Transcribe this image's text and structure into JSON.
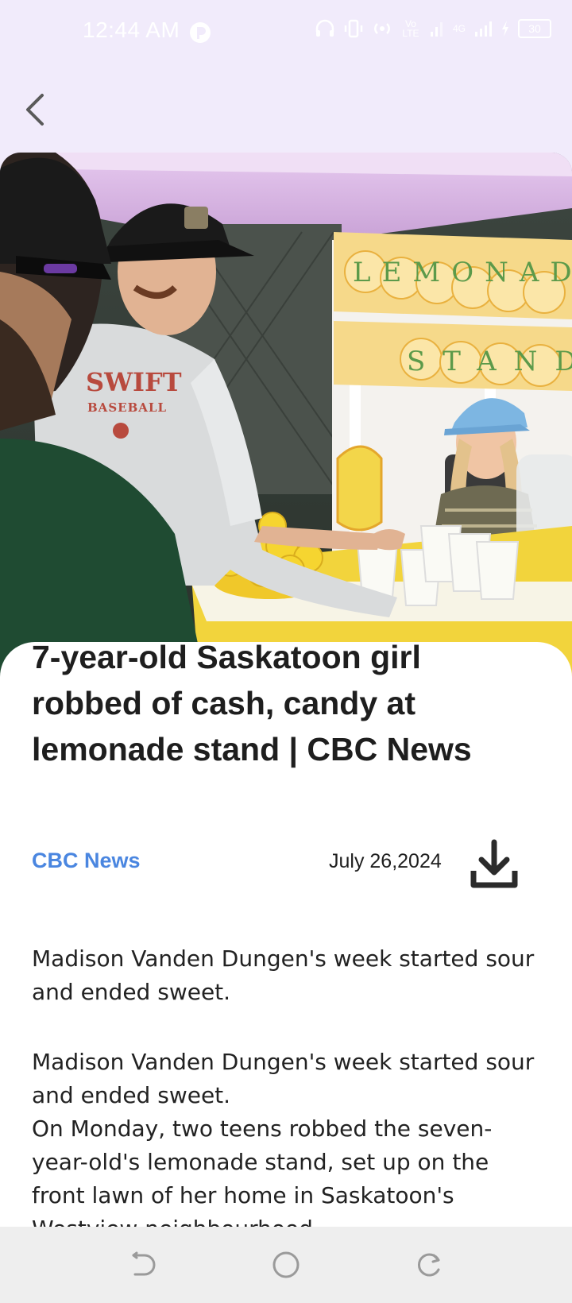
{
  "status_bar": {
    "time": "12:44 AM",
    "battery": "30",
    "network": "4G",
    "volte": "Vo LTE"
  },
  "top_bar": {
    "back_icon": "chevron-left-icon"
  },
  "hero_image": {
    "alt": "Swift Baseball players at a lemonade stand run by a girl in a blue cap"
  },
  "hero_banner": {
    "line1": "LEMONADE",
    "line2": "STAND"
  },
  "hero_shirt": {
    "line1": "SWIFT",
    "line2": "BASEBALL"
  },
  "article": {
    "headline": "7-year-old Saskatoon girl robbed of cash, candy at lemonade stand | CBC News",
    "source": "CBC News",
    "date": "July 26,2024",
    "summary": "Madison Vanden Dungen's week started sour and ended sweet.",
    "body_lead": "Madison Vanden Dungen's week started sour and ended sweet.",
    "body_continued": "On Monday, two teens robbed the seven-year-old's lemonade stand, set up on the front lawn of her home in Saskatoon's Westview neighbourhood"
  },
  "colors": {
    "accent": "#4a86e0",
    "background": "#f1ebfb"
  }
}
